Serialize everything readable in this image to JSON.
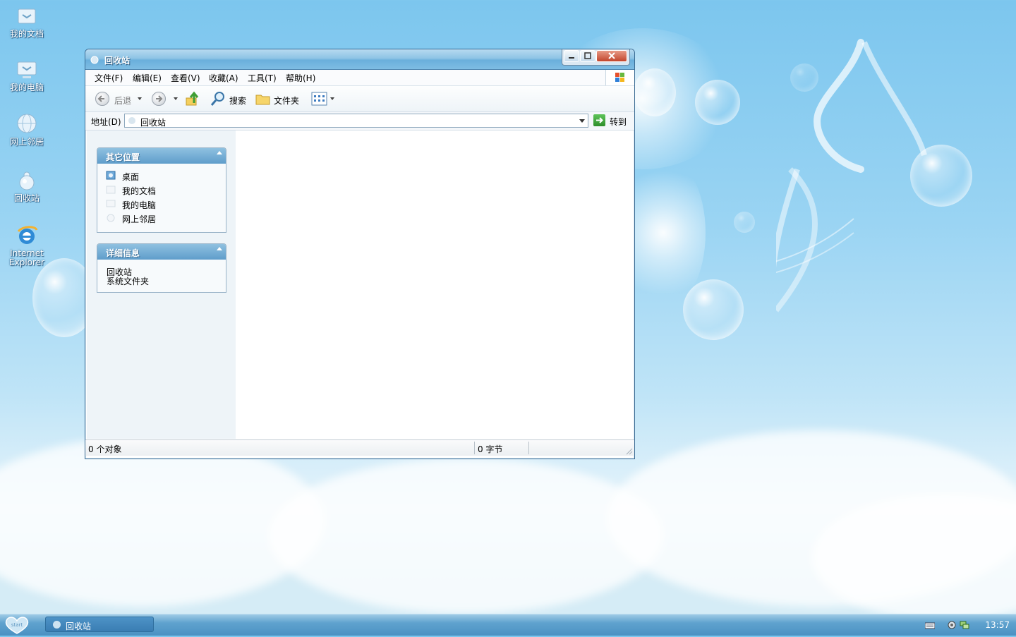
{
  "desktop": {
    "icons": [
      {
        "label": "我的文档"
      },
      {
        "label": "我的电脑"
      },
      {
        "label": "网上邻居"
      },
      {
        "label": "回收站"
      },
      {
        "label": "Internet Explorer"
      }
    ]
  },
  "window": {
    "title": "回收站",
    "menu": [
      "文件(F)",
      "编辑(E)",
      "查看(V)",
      "收藏(A)",
      "工具(T)",
      "帮助(H)"
    ],
    "toolbar": {
      "back_label": "后退",
      "search_label": "搜索",
      "folders_label": "文件夹"
    },
    "address": {
      "label": "地址(D)",
      "value": "回收站",
      "go_label": "转到"
    },
    "panels": {
      "other_places": {
        "title": "其它位置",
        "items": [
          "桌面",
          "我的文档",
          "我的电脑",
          "网上邻居"
        ]
      },
      "details": {
        "title": "详细信息",
        "name": "回收站",
        "type": "系统文件夹"
      }
    },
    "status": {
      "objects": "0 个对象",
      "bytes": "0 字节"
    }
  },
  "taskbar": {
    "start_label": "start",
    "task_item": "回收站",
    "clock": "13:57"
  },
  "colors": {
    "title_accent": "#6aafdc",
    "taskbar": "#4b91c2",
    "panel_header": "#5f9dcb"
  }
}
